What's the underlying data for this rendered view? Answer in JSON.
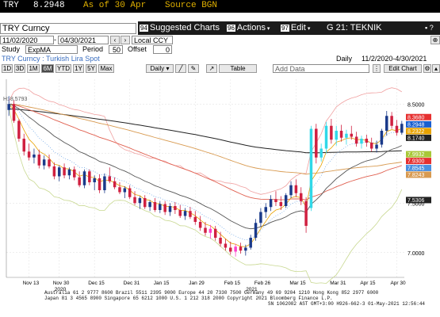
{
  "security": {
    "ticker": "TRY",
    "price": "8.2948",
    "asof": "As of 30 Apr",
    "source": "Source BGN"
  },
  "title_field": "TRY Curncy",
  "menu": {
    "suggested": {
      "num": "94",
      "label": "Suggested Charts"
    },
    "actions": {
      "num": "96",
      "label": "Actions"
    },
    "edit": {
      "num": "97",
      "label": "Edit"
    },
    "window_title": "G 21: TEKNIK COZUMLEM..."
  },
  "range": {
    "start": "11/02/2020",
    "end": "04/30/2021",
    "ccy": "Local CCY"
  },
  "study": {
    "label": "Study",
    "value": "ExpMA",
    "period_label": "Period",
    "period": "50",
    "offset_label": "Offset",
    "offset": "0"
  },
  "desc": {
    "name": "TRY Curncy : Turkish Lira Spot",
    "freq": "Daily",
    "range": "11/2/2020-4/30/2021"
  },
  "periods": [
    "1D",
    "3D",
    "1M",
    "6M",
    "YTD",
    "1Y",
    "5Y",
    "Max"
  ],
  "toolbar": {
    "daily": "Daily",
    "table": "Table",
    "add_data": "Add Data",
    "edit_chart": "Edit Chart"
  },
  "chart_data": {
    "type": "candlestick",
    "ylim": [
      6.75,
      8.75
    ],
    "y_ticks": [
      "8.5000",
      "8.0000",
      "7.5000",
      "7.0000"
    ],
    "x_ticks": [
      "Nov 13",
      "Nov 30",
      "Dec 15",
      "Dec 31",
      "Jan 15",
      "Jan 29",
      "Feb 15",
      "Feb 26",
      "Mar 15",
      "Mar 31",
      "Apr 15",
      "Apr 30"
    ],
    "x_years": [
      "2020",
      "2021"
    ],
    "annotation": "H: 8.5793",
    "price_labels": [
      {
        "value": "8.3680",
        "color": "#e63030"
      },
      {
        "value": "8.2948",
        "color": "#1a5fd0"
      },
      {
        "value": "8.2322",
        "color": "#e8a200"
      },
      {
        "value": "8.1740",
        "color": "#222222"
      },
      {
        "value": "7.9932",
        "color": "#a8c838"
      },
      {
        "value": "7.9300",
        "color": "#e63030"
      },
      {
        "value": "7.8545",
        "color": "#4a90e0"
      },
      {
        "value": "7.8243",
        "color": "#d89a50"
      },
      {
        "value": "7.5306",
        "color": "#222222"
      }
    ],
    "candles": [
      [
        8.44,
        8.58,
        8.38,
        8.5
      ],
      [
        8.5,
        8.54,
        8.31,
        8.33
      ],
      [
        8.33,
        8.35,
        8.12,
        8.15
      ],
      [
        8.15,
        8.2,
        7.98,
        8.02
      ],
      [
        8.02,
        8.1,
        7.93,
        7.96
      ],
      [
        7.96,
        8.05,
        7.9,
        7.99
      ],
      [
        7.99,
        8.04,
        7.85,
        7.88
      ],
      [
        7.88,
        7.98,
        7.84,
        7.94
      ],
      [
        7.94,
        7.99,
        7.85,
        7.87
      ],
      [
        7.87,
        7.91,
        7.74,
        7.77
      ],
      [
        7.77,
        7.88,
        7.72,
        7.86
      ],
      [
        7.86,
        7.9,
        7.75,
        7.78
      ],
      [
        7.78,
        7.86,
        7.74,
        7.84
      ],
      [
        7.84,
        7.87,
        7.73,
        7.76
      ],
      [
        7.76,
        7.82,
        7.66,
        7.68
      ],
      [
        7.68,
        7.84,
        7.65,
        7.82
      ],
      [
        7.82,
        7.84,
        7.68,
        7.71
      ],
      [
        7.71,
        7.78,
        7.63,
        7.75
      ],
      [
        7.75,
        7.79,
        7.6,
        7.63
      ],
      [
        7.63,
        7.8,
        7.6,
        7.77
      ],
      [
        7.77,
        7.86,
        7.7,
        7.72
      ],
      [
        7.72,
        7.76,
        7.64,
        7.66
      ],
      [
        7.66,
        7.71,
        7.59,
        7.61
      ],
      [
        7.61,
        7.67,
        7.55,
        7.65
      ],
      [
        7.65,
        7.68,
        7.54,
        7.56
      ],
      [
        7.56,
        7.62,
        7.48,
        7.5
      ],
      [
        7.5,
        7.57,
        7.44,
        7.55
      ],
      [
        7.55,
        7.58,
        7.44,
        7.46
      ],
      [
        7.46,
        7.53,
        7.42,
        7.51
      ],
      [
        7.51,
        7.55,
        7.41,
        7.43
      ],
      [
        7.43,
        7.52,
        7.4,
        7.49
      ],
      [
        7.49,
        7.52,
        7.38,
        7.41
      ],
      [
        7.41,
        7.5,
        7.37,
        7.47
      ],
      [
        7.47,
        7.51,
        7.39,
        7.43
      ],
      [
        7.43,
        7.48,
        7.35,
        7.37
      ],
      [
        7.37,
        7.45,
        7.33,
        7.42
      ],
      [
        7.42,
        7.46,
        7.34,
        7.36
      ],
      [
        7.36,
        7.42,
        7.28,
        7.31
      ],
      [
        7.31,
        7.37,
        7.22,
        7.25
      ],
      [
        7.25,
        7.31,
        7.17,
        7.2
      ],
      [
        7.2,
        7.28,
        7.14,
        7.24
      ],
      [
        7.24,
        7.27,
        7.12,
        7.15
      ],
      [
        7.15,
        7.21,
        7.06,
        7.09
      ],
      [
        7.09,
        7.14,
        7.02,
        7.05
      ],
      [
        7.05,
        7.11,
        6.98,
        7.01
      ],
      [
        7.01,
        7.09,
        6.96,
        7.06
      ],
      [
        7.06,
        7.1,
        6.99,
        7.02
      ],
      [
        7.02,
        7.08,
        6.97,
        7.05
      ],
      [
        7.05,
        7.18,
        7.03,
        7.15
      ],
      [
        7.15,
        7.34,
        7.12,
        7.3
      ],
      [
        7.3,
        7.45,
        7.26,
        7.41
      ],
      [
        7.41,
        7.5,
        7.35,
        7.46
      ],
      [
        7.46,
        7.58,
        7.42,
        7.54
      ],
      [
        7.54,
        7.62,
        7.47,
        7.51
      ],
      [
        7.51,
        7.57,
        7.43,
        7.47
      ],
      [
        7.47,
        7.6,
        7.45,
        7.58
      ],
      [
        7.58,
        7.72,
        7.55,
        7.68
      ],
      [
        7.68,
        7.74,
        7.56,
        7.6
      ],
      [
        7.6,
        7.66,
        7.48,
        7.52
      ],
      [
        7.52,
        7.56,
        7.2,
        7.27
      ],
      [
        7.45,
        8.28,
        7.42,
        8.25
      ],
      [
        8.25,
        8.3,
        7.9,
        7.96
      ],
      [
        7.96,
        8.1,
        7.92,
        8.05
      ],
      [
        8.05,
        8.32,
        8.0,
        8.28
      ],
      [
        8.28,
        8.35,
        8.1,
        8.14
      ],
      [
        8.14,
        8.28,
        8.08,
        8.23
      ],
      [
        8.23,
        8.29,
        8.12,
        8.16
      ],
      [
        8.16,
        8.24,
        8.09,
        8.2
      ],
      [
        8.2,
        8.28,
        8.14,
        8.17
      ],
      [
        8.17,
        8.22,
        8.07,
        8.1
      ],
      [
        8.1,
        8.18,
        8.05,
        8.15
      ],
      [
        8.15,
        8.19,
        8.07,
        8.11
      ],
      [
        8.11,
        8.16,
        8.02,
        8.05
      ],
      [
        8.05,
        8.13,
        8.01,
        8.09
      ],
      [
        8.09,
        8.25,
        8.06,
        8.23
      ],
      [
        8.23,
        8.43,
        8.18,
        8.38
      ],
      [
        8.38,
        8.42,
        8.25,
        8.28
      ],
      [
        8.28,
        8.34,
        8.18,
        8.21
      ],
      [
        8.21,
        8.33,
        8.19,
        8.3
      ]
    ]
  },
  "footer": {
    "line1": "Australia 61 2 9777 8600  Brazil 5511 2395 9000  Europe 44 20 7330 7500  Germany 49 69 9204 1210  Hong Kong 852 2977 6000",
    "line2": "Japan 81 3 4565 8900        Singapore 65 6212 1000        U.S. 1 212 318 2000              Copyright 2021 Bloomberg Finance L.P.",
    "line3": "SN 1062082 AST  GMT+3:00 H926-662-3 01-May-2021 12:56:44"
  }
}
